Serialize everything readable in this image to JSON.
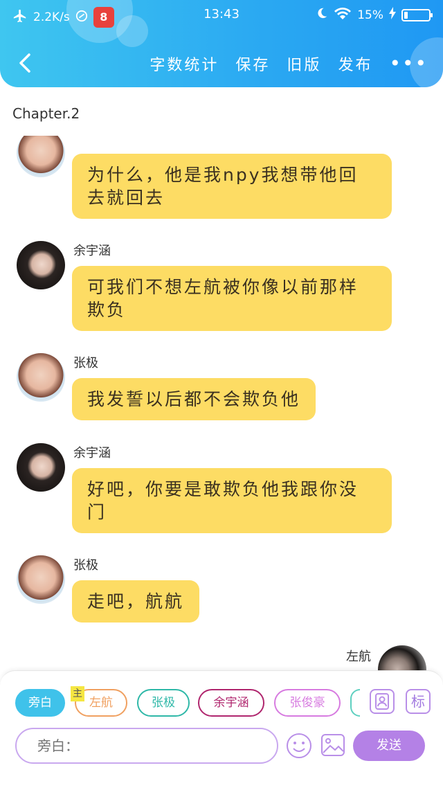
{
  "status_bar": {
    "network_speed": "2.2K/s",
    "time": "13:43",
    "battery_percent": "15%",
    "battery_level": 0.15,
    "app_badge": "8"
  },
  "nav": {
    "actions": [
      "字数统计",
      "保存",
      "旧版",
      "发布"
    ],
    "more": "•••"
  },
  "chapter_label": "Chapter.2",
  "messages": [
    {
      "speaker": "张极",
      "avatar": "zj",
      "text": "为什么，他是我npy我想带他回去就回去",
      "name_visible": false
    },
    {
      "speaker": "余宇涵",
      "avatar": "yyh",
      "text": "可我们不想左航被你像以前那样欺负"
    },
    {
      "speaker": "张极",
      "avatar": "zj",
      "text": "我发誓以后都不会欺负他"
    },
    {
      "speaker": "余宇涵",
      "avatar": "yyh",
      "text": "好吧，你要是敢欺负他我跟你没门"
    },
    {
      "speaker": "张极",
      "avatar": "zj",
      "text": "走吧，航航"
    },
    {
      "speaker": "左航",
      "avatar": "zh",
      "text": ""
    }
  ],
  "composer": {
    "roles": [
      {
        "label": "旁白",
        "active": true,
        "color": "#3fc2ea"
      },
      {
        "label": "左航",
        "active": false,
        "color": "#f0a060",
        "owner": true
      },
      {
        "label": "张极",
        "active": false,
        "color": "#2fb8a8"
      },
      {
        "label": "余宇涵",
        "active": false,
        "color": "#b0266e"
      },
      {
        "label": "张俊豪",
        "active": false,
        "color": "#d77be0"
      }
    ],
    "owner_tag": "主",
    "tool_label": "标",
    "input_placeholder": "旁白：",
    "send_label": "发送"
  }
}
